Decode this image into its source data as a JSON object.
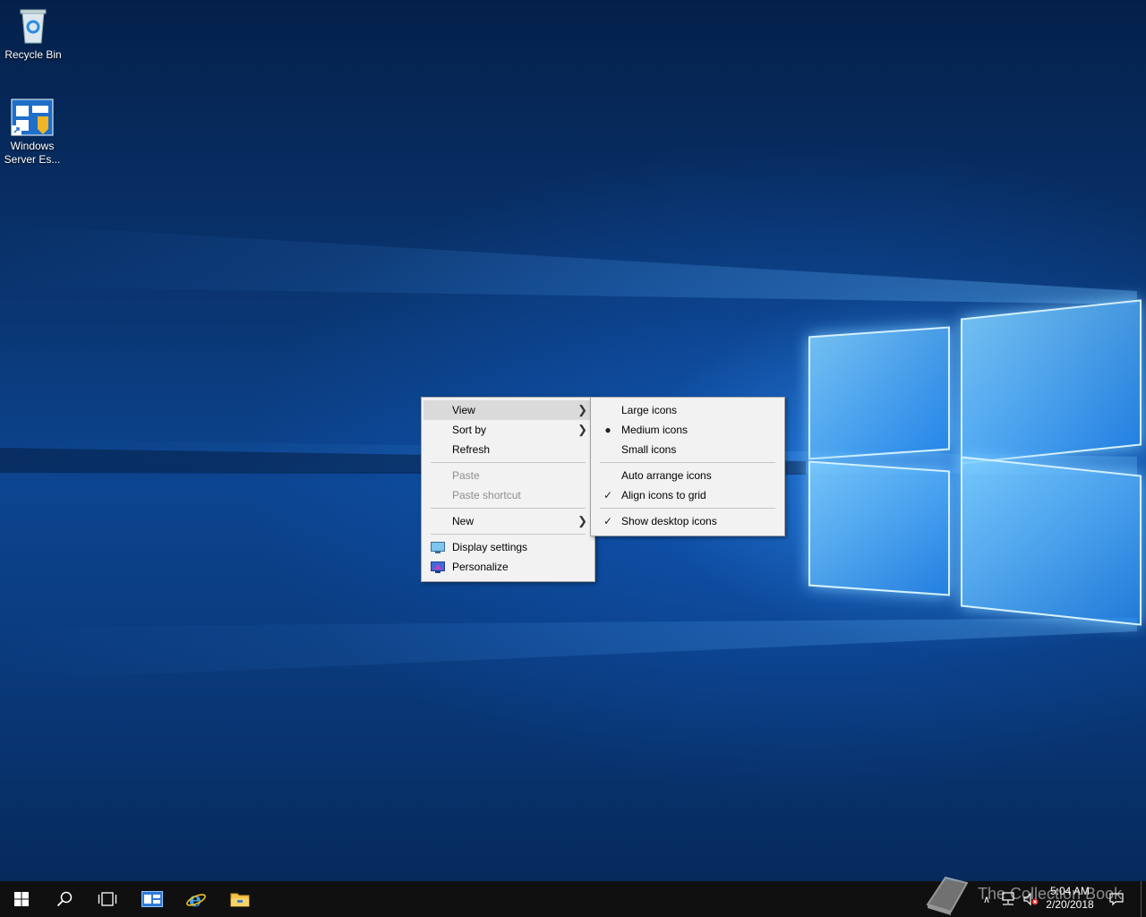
{
  "desktop_icons": {
    "recycle_bin": "Recycle Bin",
    "server_essentials": "Windows Server Es..."
  },
  "context_menu": {
    "items": [
      {
        "label": "View",
        "submenu": true,
        "highlighted": true
      },
      {
        "label": "Sort by",
        "submenu": true
      },
      {
        "label": "Refresh"
      },
      {
        "label": "Paste",
        "disabled": true
      },
      {
        "label": "Paste shortcut",
        "disabled": true
      },
      {
        "label": "New",
        "submenu": true
      },
      {
        "label": "Display settings",
        "icon": "display-icon"
      },
      {
        "label": "Personalize",
        "icon": "personalize-icon"
      }
    ]
  },
  "view_submenu": {
    "items": [
      {
        "label": "Large icons"
      },
      {
        "label": "Medium icons",
        "mark": "bullet"
      },
      {
        "label": "Small icons"
      },
      {
        "label": "Auto arrange icons"
      },
      {
        "label": "Align icons to grid",
        "mark": "check"
      },
      {
        "label": "Show desktop icons",
        "mark": "check"
      }
    ]
  },
  "taskbar": {
    "buttons": [
      "start-icon",
      "search-icon",
      "task-view-icon",
      "server-manager-icon",
      "internet-explorer-icon",
      "file-explorer-icon"
    ],
    "clock_time": "5:04 AM",
    "clock_date": "2/20/2018"
  },
  "watermark": "The Collection Book",
  "colors": {
    "menu_bg": "#f2f2f2",
    "menu_highlight": "#dadada",
    "taskbar_bg": "#101010",
    "wallpaper_blue": "#0c4590"
  }
}
